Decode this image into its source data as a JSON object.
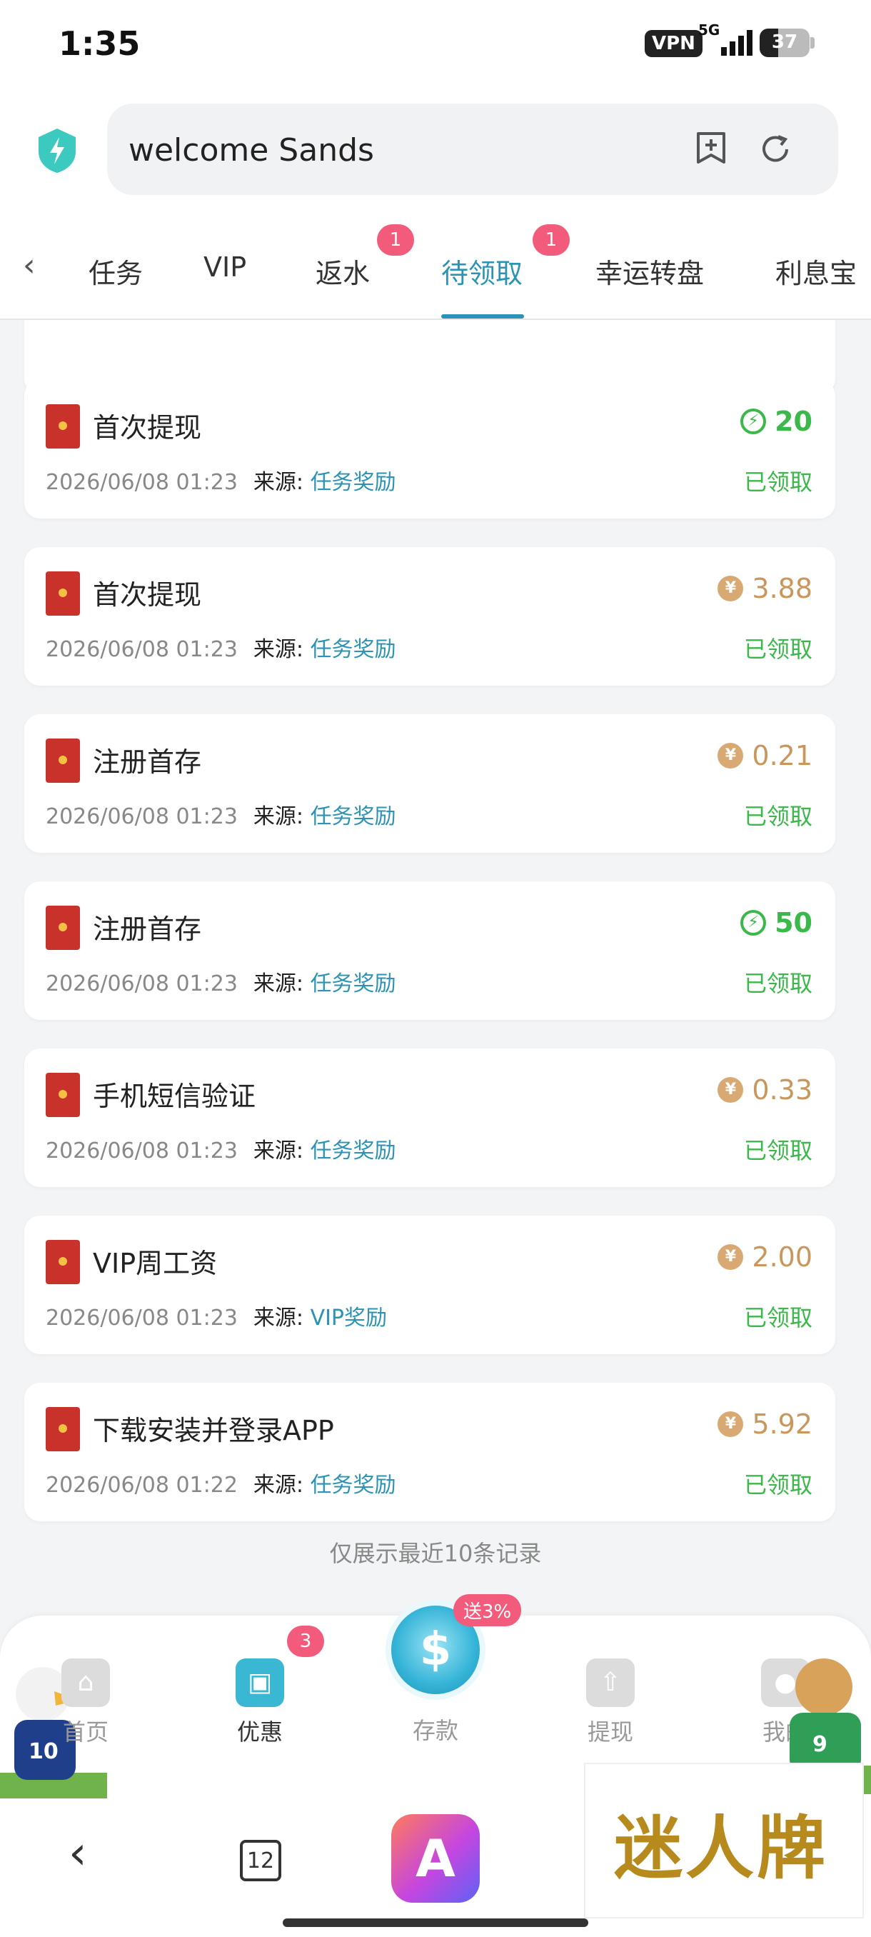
{
  "status_bar": {
    "time": "1:35",
    "vpn": "VPN",
    "network": "5G",
    "battery": "37",
    "battery_level": 0.37
  },
  "browser": {
    "url_text": "welcome Sands",
    "icons": [
      "shield-bolt-icon",
      "add-bookmark-icon",
      "refresh-icon"
    ]
  },
  "tabs": {
    "items": [
      {
        "label": "任务"
      },
      {
        "label": "VIP"
      },
      {
        "label": "返水",
        "badge": "1"
      },
      {
        "label": "待领取",
        "badge": "1",
        "active": true
      },
      {
        "label": "幸运转盘"
      },
      {
        "label": "利息宝"
      }
    ]
  },
  "records": [
    {
      "title": "首次提现",
      "time": "2026/06/08 01:23",
      "source_label": "来源:",
      "source": "任务奖励",
      "amount": "20",
      "amount_type": "green",
      "status": "已领取"
    },
    {
      "title": "首次提现",
      "time": "2026/06/08 01:23",
      "source_label": "来源:",
      "source": "任务奖励",
      "amount": "3.88",
      "amount_type": "gold",
      "status": "已领取"
    },
    {
      "title": "注册首存",
      "time": "2026/06/08 01:23",
      "source_label": "来源:",
      "source": "任务奖励",
      "amount": "0.21",
      "amount_type": "gold",
      "status": "已领取"
    },
    {
      "title": "注册首存",
      "time": "2026/06/08 01:23",
      "source_label": "来源:",
      "source": "任务奖励",
      "amount": "50",
      "amount_type": "green",
      "status": "已领取"
    },
    {
      "title": "手机短信验证",
      "time": "2026/06/08 01:23",
      "source_label": "来源:",
      "source": "任务奖励",
      "amount": "0.33",
      "amount_type": "gold",
      "status": "已领取"
    },
    {
      "title": "VIP周工资",
      "time": "2026/06/08 01:23",
      "source_label": "来源:",
      "source": "VIP奖励",
      "amount": "2.00",
      "amount_type": "gold",
      "status": "已领取"
    },
    {
      "title": "下载安装并登录APP",
      "time": "2026/06/08 01:22",
      "source_label": "来源:",
      "source": "任务奖励",
      "amount": "5.92",
      "amount_type": "gold",
      "status": "已领取"
    }
  ],
  "footer_note": "仅展示最近10条记录",
  "bottom_nav": {
    "home": "首页",
    "promo": "优惠",
    "promo_badge": "3",
    "deposit": "存款",
    "deposit_badge": "送3%",
    "withdraw": "提现",
    "mine": "我的"
  },
  "system_nav": {
    "tab_count": "12"
  },
  "ad": {
    "text": "迷人牌"
  }
}
